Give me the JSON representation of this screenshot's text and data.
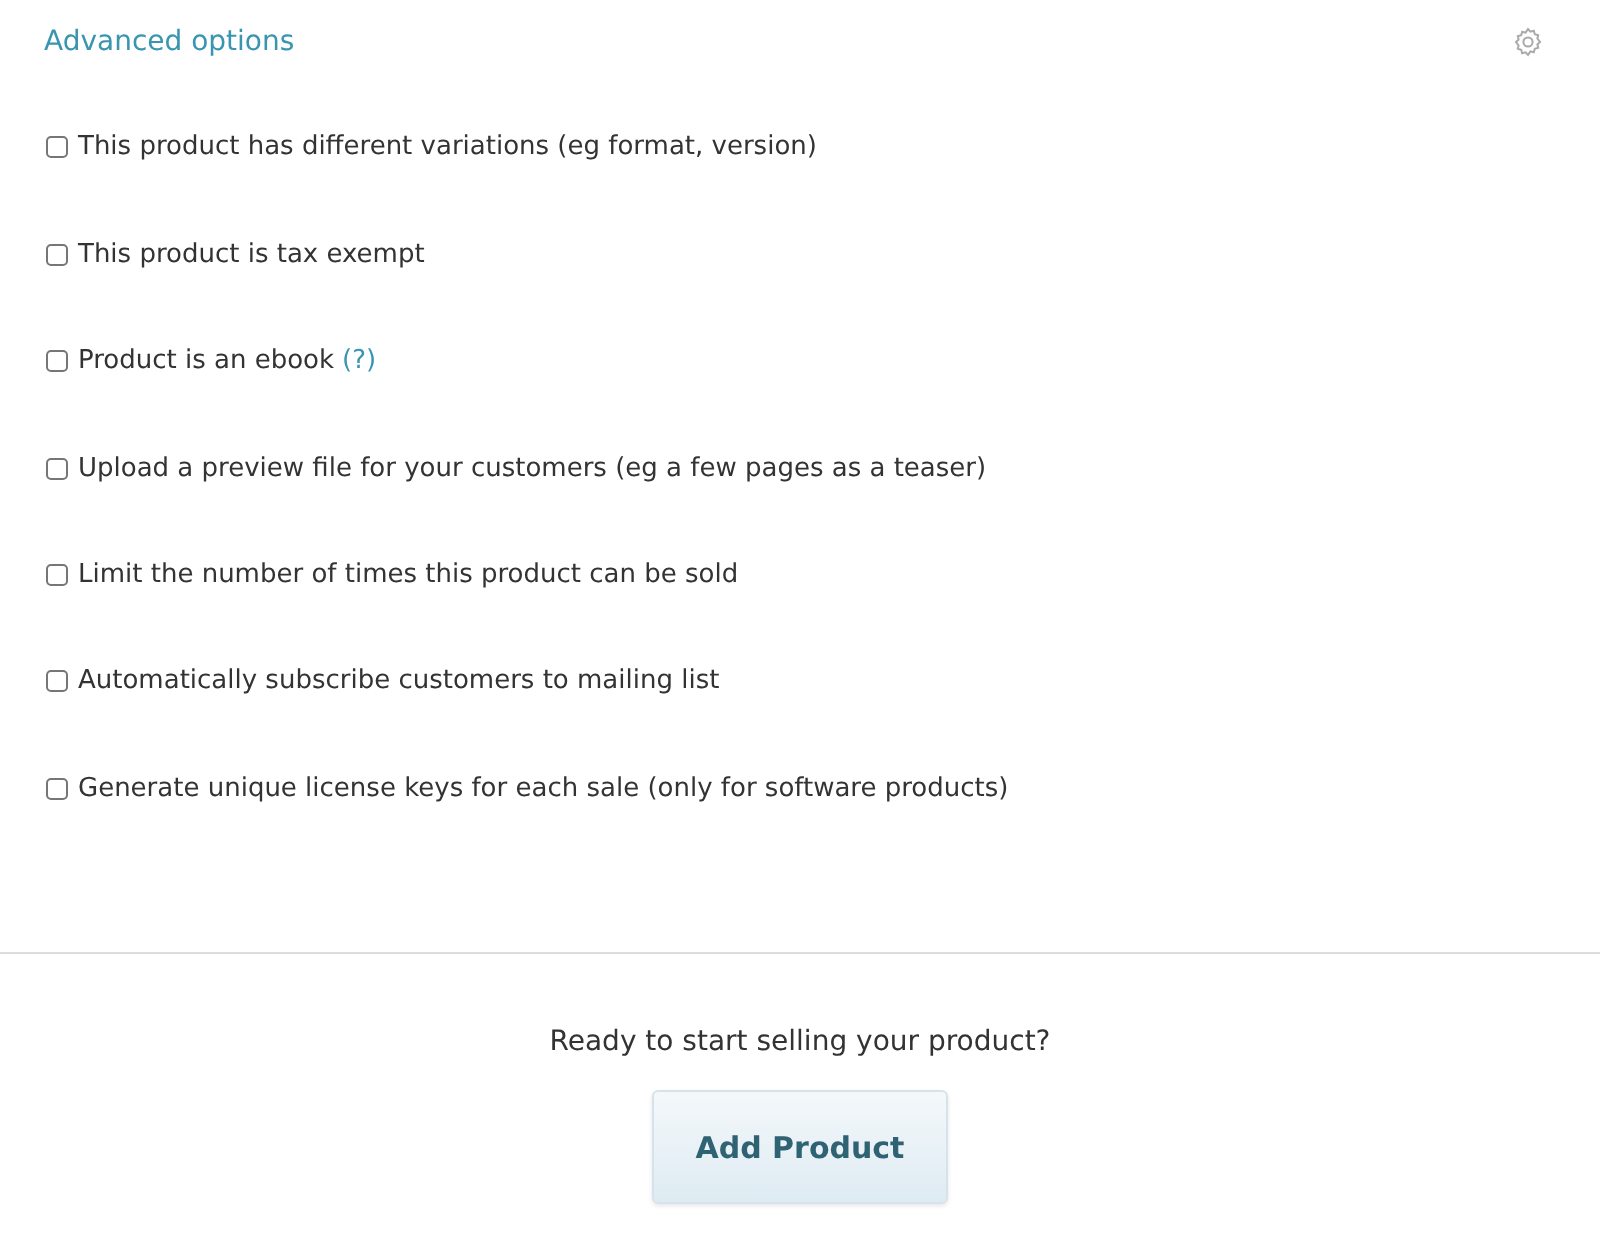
{
  "section_title": "Advanced options",
  "options": [
    {
      "label": "This product has different variations (eg format, version)",
      "checked": false
    },
    {
      "label": "This product is tax exempt",
      "checked": false
    },
    {
      "label": "Product is an ebook",
      "checked": false,
      "help": "(?)"
    },
    {
      "label": "Upload a preview file for your customers (eg a few pages as a teaser)",
      "checked": false
    },
    {
      "label": "Limit the number of times this product can be sold",
      "checked": false
    },
    {
      "label": "Automatically subscribe customers to mailing list",
      "checked": false
    },
    {
      "label": "Generate unique license keys for each sale (only for software products)",
      "checked": false
    }
  ],
  "footer": {
    "prompt": "Ready to start selling your product?",
    "button": "Add Product"
  }
}
